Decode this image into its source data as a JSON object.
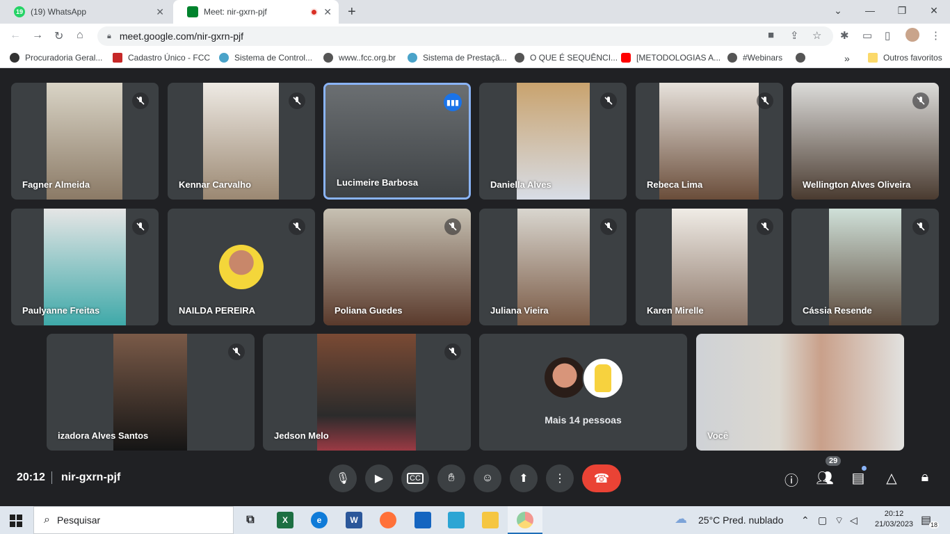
{
  "browser": {
    "tabs": [
      {
        "title": "(19) WhatsApp",
        "badge": "19"
      },
      {
        "title": "Meet: nir-gxrn-pjf"
      }
    ],
    "url": "meet.google.com/nir-gxrn-pjf",
    "bookmarks": [
      "Procuradoria Geral...",
      "Cadastro Único - FCC",
      "Sistema de Control...",
      "www..fcc.org.br",
      "Sistema de Prestaçã...",
      "O QUE É SEQUÊNCI...",
      "[METODOLOGIAS A...",
      "#Webinars"
    ],
    "other_bookmarks": "Outros favoritos"
  },
  "meet": {
    "participants": [
      {
        "name": "Fagner Almeida",
        "muted": true
      },
      {
        "name": "Kennar Carvalho",
        "muted": true
      },
      {
        "name": "Lucimeire Barbosa",
        "speaking": true
      },
      {
        "name": "Daniella Alves",
        "muted": true
      },
      {
        "name": "Rebeca Lima",
        "muted": true
      },
      {
        "name": "Wellington Alves Oliveira",
        "muted": true
      },
      {
        "name": "Paulyanne Freitas",
        "muted": true
      },
      {
        "name": "NAILDA PEREIRA",
        "muted": true
      },
      {
        "name": "Poliana Guedes",
        "muted": true
      },
      {
        "name": "Juliana Vieira",
        "muted": true
      },
      {
        "name": "Karen Mirelle",
        "muted": true
      },
      {
        "name": "Cássia Resende",
        "muted": true
      },
      {
        "name": "izadora Alves Santos",
        "muted": true
      },
      {
        "name": "Jedson Melo",
        "muted": true
      },
      {
        "name": "Você",
        "muted": false
      }
    ],
    "more_people": "Mais 14 pessoas",
    "time": "20:12",
    "meeting_code": "nir-gxrn-pjf",
    "people_count": "29"
  },
  "taskbar": {
    "search_placeholder": "Pesquisar",
    "weather": "25°C  Pred. nublado",
    "clock_time": "20:12",
    "clock_date": "21/03/2023",
    "notification_count": "18"
  },
  "colors": {
    "meet_bg": "#202124",
    "tile_bg": "#3c4043",
    "hangup": "#ea4335",
    "speaking": "#1a73e8"
  }
}
